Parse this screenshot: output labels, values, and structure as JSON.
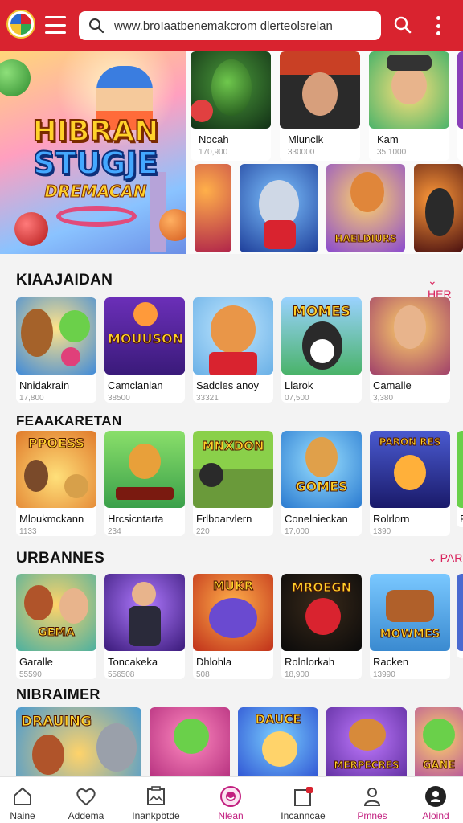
{
  "header": {
    "search_url": "www.broIaatbenemakcrom dlerteolsrelan",
    "colors": {
      "bar": "#d9232f",
      "accent": "#d9235c"
    },
    "icons": [
      "app-logo-icon",
      "menu-icon",
      "search-icon",
      "more-vertical-icon"
    ]
  },
  "hero": {
    "banner": {
      "line1": "HIBRAN",
      "line2": "STUGJE",
      "line3": "DREMACAN"
    },
    "cards": [
      {
        "name": "Nocah",
        "count": "170,900"
      },
      {
        "name": "Mlunclk",
        "count": "330000"
      },
      {
        "name": "Kam",
        "count": "35,1000"
      },
      {
        "name": "S",
        "count": ""
      }
    ],
    "tiles": [
      {
        "label": ""
      },
      {
        "label": ""
      },
      {
        "label": "HAELDIURS"
      },
      {
        "label": ""
      }
    ]
  },
  "sections": [
    {
      "title": "KIAAJAIDAN",
      "see_more": "HER",
      "items": [
        {
          "name": "Nnidakrain",
          "count": "17,800",
          "art_text": ""
        },
        {
          "name": "Camclanlan",
          "count": "38500",
          "art_text": "MOUUSON"
        },
        {
          "name": "Sadcles anoy",
          "count": "33321",
          "art_text": ""
        },
        {
          "name": "Llarok",
          "count": "07,500",
          "art_text": "MOMES"
        },
        {
          "name": "Camalle",
          "count": "3,380",
          "art_text": ""
        }
      ]
    },
    {
      "title": "FEAAKARETAN",
      "see_more": "",
      "items": [
        {
          "name": "Mloukmckann",
          "count": "1133",
          "art_text": "PPOESS"
        },
        {
          "name": "Hrcsicntarta",
          "count": "234",
          "art_text": ""
        },
        {
          "name": "Frlboarvlern",
          "count": "220",
          "art_text": "MNXDON"
        },
        {
          "name": "Conelnieckan",
          "count": "17,000",
          "art_text": "GOMES"
        },
        {
          "name": "Rolrlorn",
          "count": "1390",
          "art_text": "PARON RES"
        },
        {
          "name": "F",
          "count": "",
          "art_text": ""
        }
      ]
    },
    {
      "title": "URBANNES",
      "see_more": "PAR",
      "items": [
        {
          "name": "Garalle",
          "count": "55590",
          "art_text": "GEMA"
        },
        {
          "name": "Toncakeka",
          "count": "556508",
          "art_text": ""
        },
        {
          "name": "Dhlohla",
          "count": "508",
          "art_text": "MUKR"
        },
        {
          "name": "Rolnlorkah",
          "count": "18,900",
          "art_text": "MROEGN"
        },
        {
          "name": "Racken",
          "count": "13990",
          "art_text": "MOWMES"
        },
        {
          "name": "",
          "count": "",
          "art_text": ""
        }
      ]
    },
    {
      "title": "NIBRAIMER",
      "see_more": "",
      "items": [
        {
          "name": "",
          "count": "",
          "art_text": "DRAUING"
        },
        {
          "name": "",
          "count": "",
          "art_text": ""
        },
        {
          "name": "",
          "count": "",
          "art_text": "DAUCE"
        },
        {
          "name": "",
          "count": "",
          "art_text": "MERPECRES"
        },
        {
          "name": "",
          "count": "",
          "art_text": "GANE"
        }
      ]
    }
  ],
  "bottom_nav": [
    {
      "label": "Naine",
      "icon": "home-icon"
    },
    {
      "label": "Addema",
      "icon": "heart-icon"
    },
    {
      "label": "Inankpbtde",
      "icon": "photo-frame-icon"
    },
    {
      "label": "Nlean",
      "icon": "smiley-icon"
    },
    {
      "label": "Incanncae",
      "icon": "notification-icon"
    },
    {
      "label": "Pmnes",
      "icon": "user-icon"
    },
    {
      "label": "Aloind",
      "icon": "account-circle-icon"
    }
  ]
}
